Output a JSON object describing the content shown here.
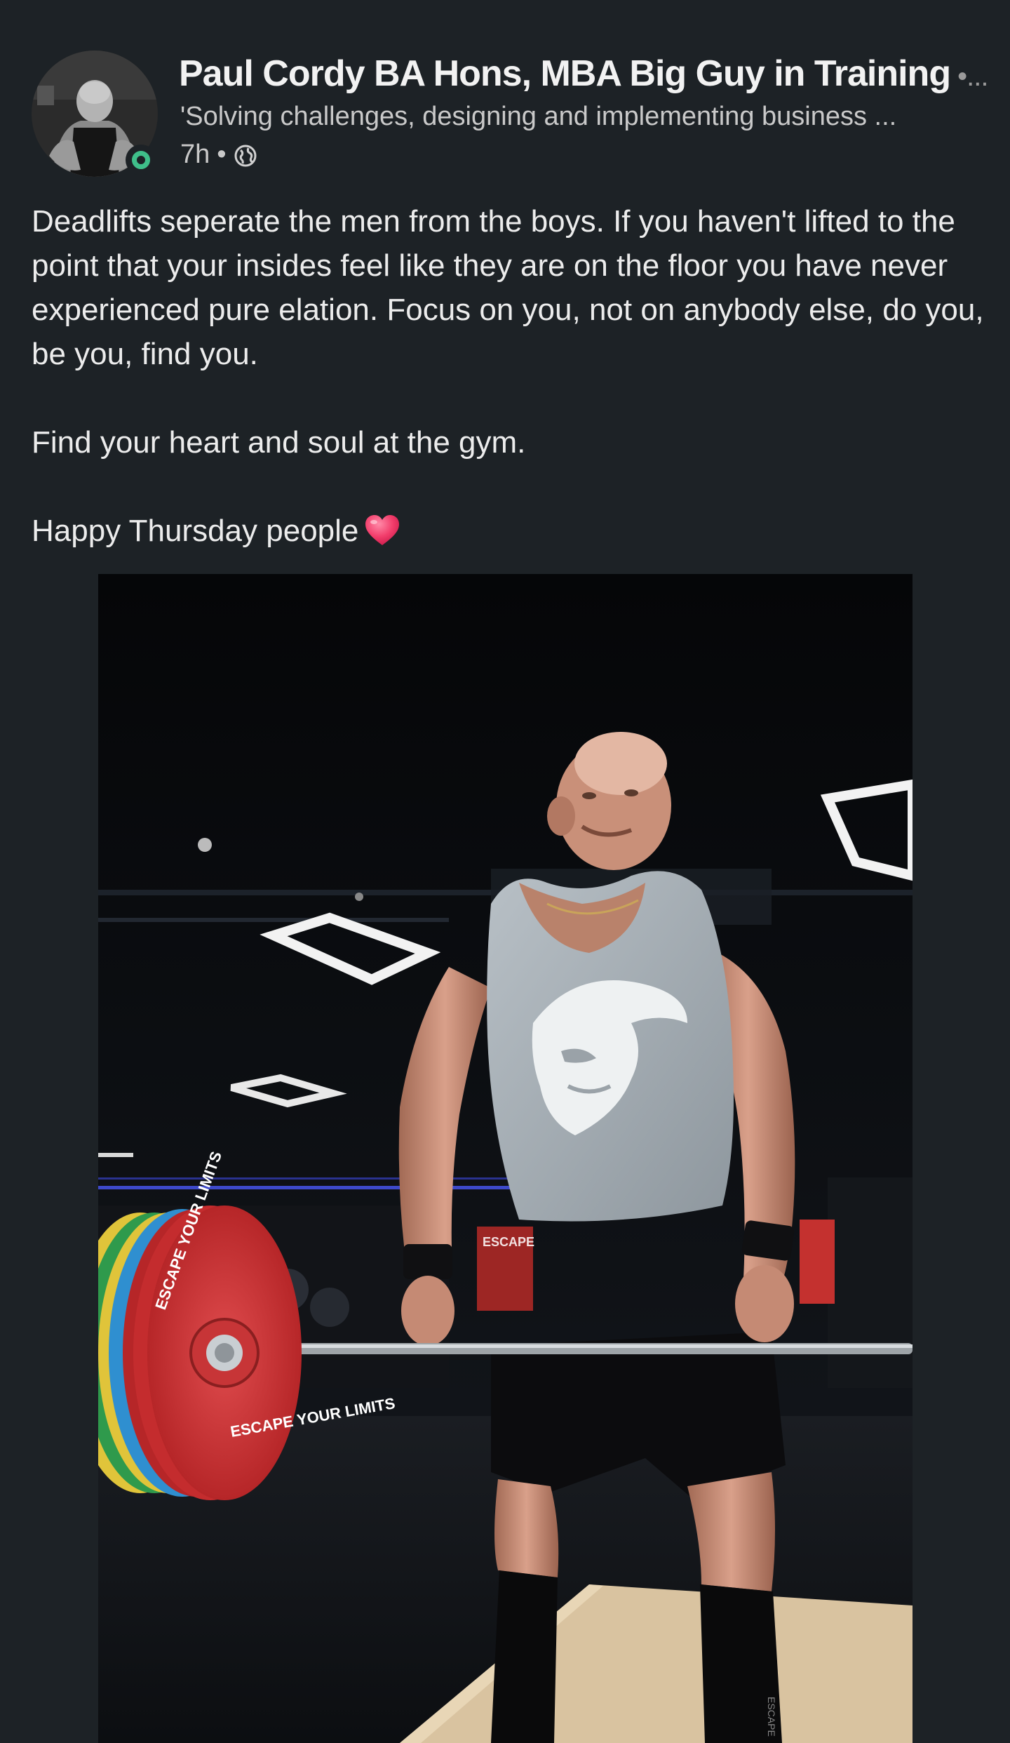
{
  "post": {
    "author": {
      "name": "Paul Cordy BA Hons, MBA Big Guy in Training",
      "separator_more": "•...",
      "headline": "'Solving challenges, designing and implementing business ...",
      "time": "7h",
      "meta_separator": "•",
      "visibility_icon": "globe-icon",
      "avatar_icon": "avatar",
      "online_status_color": "#3fbf8a"
    },
    "body": {
      "paragraph1": "Deadlifts seperate the men from the boys. If you haven't lifted to the point that your insides feel like they are on the floor you have never experienced pure elation. Focus on you, not on anybody else, do you, be you, find you.",
      "paragraph2": "Find your heart and soul at the gym.",
      "paragraph3": "Happy Thursday people",
      "emoji_icon": "heart-icon"
    },
    "image": {
      "plate_text_1": "ESCAPE YOUR LIMITS",
      "plate_text_2": "ESCAPE YOUR LIMITS",
      "sign_text": "ESCAPE",
      "sock_text": "ESCAPE"
    }
  },
  "colors": {
    "background": "#1d2226",
    "text": "#ececec",
    "muted": "#c9c9c9",
    "plate_red": "#d8393b"
  }
}
